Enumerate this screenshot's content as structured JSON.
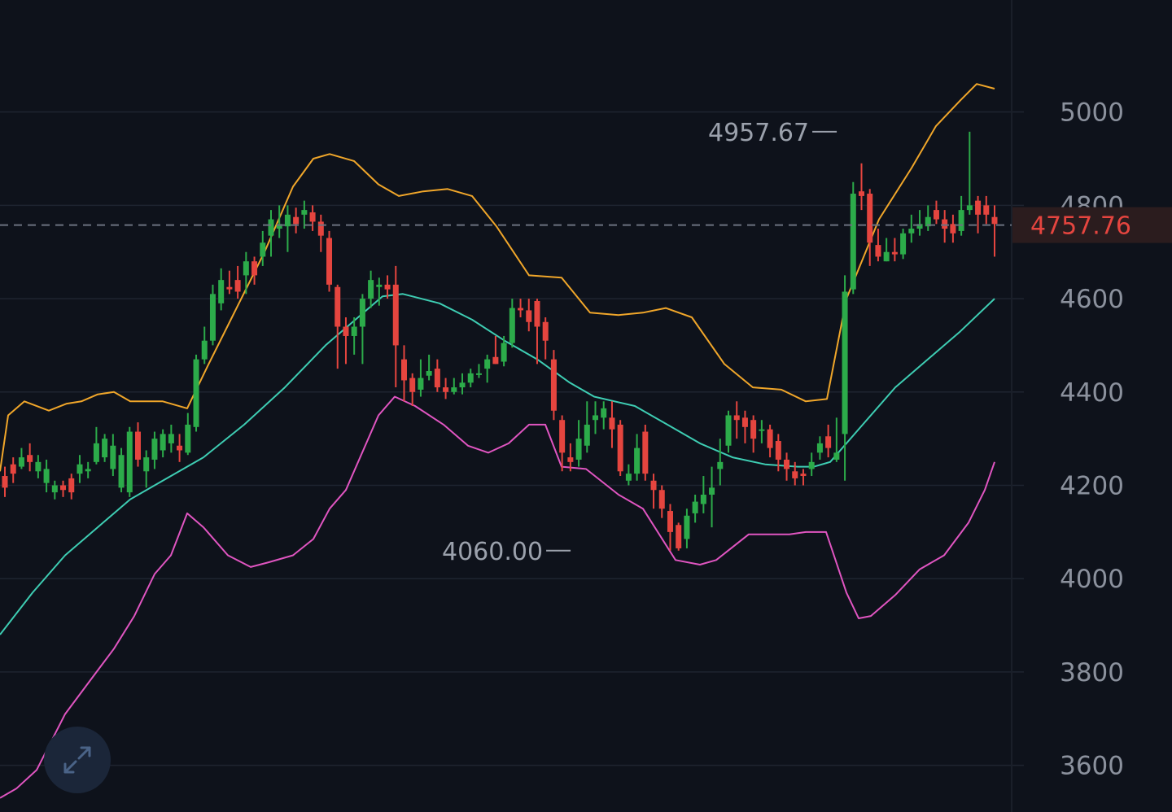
{
  "chart_data": {
    "type": "candlestick",
    "y_axis": {
      "ticks": [
        "5000",
        "4800",
        "4600",
        "4400",
        "4200",
        "4000",
        "3800",
        "3600"
      ],
      "tick_values": [
        5000,
        4800,
        4600,
        4400,
        4200,
        4000,
        3800,
        3600
      ],
      "range": [
        3500,
        5240
      ],
      "position": "right",
      "grid": true
    },
    "current_price": {
      "label": "4757.76",
      "value": 4757.76
    },
    "annotations": [
      {
        "id": "high",
        "label": "4957.67",
        "value": 4957.67,
        "candle_index": 101
      },
      {
        "id": "low",
        "label": "4060.00",
        "value": 4060.0,
        "candle_index": 69
      }
    ],
    "candles": [
      [
        4220,
        4195,
        4240,
        4175
      ],
      [
        4245,
        4225,
        4260,
        4205
      ],
      [
        4240,
        4260,
        4280,
        4235
      ],
      [
        4265,
        4250,
        4290,
        4230
      ],
      [
        4230,
        4250,
        4265,
        4215
      ],
      [
        4205,
        4235,
        4255,
        4185
      ],
      [
        4185,
        4200,
        4210,
        4170
      ],
      [
        4200,
        4190,
        4210,
        4175
      ],
      [
        4215,
        4185,
        4225,
        4170
      ],
      [
        4225,
        4245,
        4265,
        4205
      ],
      [
        4230,
        4235,
        4250,
        4215
      ],
      [
        4250,
        4290,
        4325,
        4245
      ],
      [
        4260,
        4300,
        4310,
        4250
      ],
      [
        4235,
        4285,
        4310,
        4220
      ],
      [
        4195,
        4265,
        4280,
        4185
      ],
      [
        4185,
        4315,
        4325,
        4175
      ],
      [
        4315,
        4255,
        4335,
        4240
      ],
      [
        4230,
        4260,
        4275,
        4195
      ],
      [
        4255,
        4300,
        4315,
        4235
      ],
      [
        4275,
        4310,
        4320,
        4260
      ],
      [
        4290,
        4310,
        4330,
        4270
      ],
      [
        4285,
        4275,
        4310,
        4250
      ],
      [
        4270,
        4330,
        4355,
        4265
      ],
      [
        4325,
        4470,
        4480,
        4315
      ],
      [
        4470,
        4510,
        4540,
        4460
      ],
      [
        4510,
        4610,
        4630,
        4500
      ],
      [
        4590,
        4640,
        4665,
        4575
      ],
      [
        4625,
        4620,
        4660,
        4610
      ],
      [
        4640,
        4615,
        4670,
        4600
      ],
      [
        4650,
        4680,
        4700,
        4610
      ],
      [
        4680,
        4650,
        4690,
        4630
      ],
      [
        4690,
        4720,
        4745,
        4670
      ],
      [
        4735,
        4770,
        4790,
        4690
      ],
      [
        4750,
        4760,
        4800,
        4730
      ],
      [
        4755,
        4780,
        4800,
        4700
      ],
      [
        4775,
        4760,
        4795,
        4740
      ],
      [
        4780,
        4790,
        4810,
        4750
      ],
      [
        4785,
        4765,
        4800,
        4745
      ],
      [
        4765,
        4735,
        4780,
        4700
      ],
      [
        4730,
        4630,
        4745,
        4615
      ],
      [
        4625,
        4540,
        4630,
        4450
      ],
      [
        4540,
        4520,
        4560,
        4460
      ],
      [
        4520,
        4540,
        4560,
        4480
      ],
      [
        4540,
        4600,
        4610,
        4460
      ],
      [
        4600,
        4640,
        4660,
        4580
      ],
      [
        4625,
        4630,
        4645,
        4585
      ],
      [
        4630,
        4620,
        4650,
        4600
      ],
      [
        4630,
        4500,
        4670,
        4410
      ],
      [
        4470,
        4425,
        4500,
        4380
      ],
      [
        4430,
        4400,
        4440,
        4370
      ],
      [
        4405,
        4430,
        4470,
        4390
      ],
      [
        4435,
        4445,
        4480,
        4425
      ],
      [
        4450,
        4410,
        4470,
        4400
      ],
      [
        4410,
        4400,
        4430,
        4385
      ],
      [
        4400,
        4410,
        4430,
        4395
      ],
      [
        4410,
        4420,
        4440,
        4395
      ],
      [
        4420,
        4440,
        4450,
        4410
      ],
      [
        4440,
        4440,
        4460,
        4430
      ],
      [
        4450,
        4470,
        4480,
        4420
      ],
      [
        4475,
        4460,
        4520,
        4460
      ],
      [
        4465,
        4505,
        4520,
        4455
      ],
      [
        4505,
        4580,
        4600,
        4495
      ],
      [
        4580,
        4575,
        4600,
        4560
      ],
      [
        4575,
        4550,
        4600,
        4530
      ],
      [
        4595,
        4540,
        4600,
        4460
      ],
      [
        4550,
        4510,
        4560,
        4470
      ],
      [
        4470,
        4360,
        4490,
        4340
      ],
      [
        4340,
        4270,
        4350,
        4230
      ],
      [
        4260,
        4250,
        4290,
        4230
      ],
      [
        4255,
        4300,
        4340,
        4240
      ],
      [
        4285,
        4330,
        4380,
        4270
      ],
      [
        4340,
        4350,
        4380,
        4310
      ],
      [
        4345,
        4365,
        4380,
        4320
      ],
      [
        4345,
        4320,
        4380,
        4280
      ],
      [
        4330,
        4230,
        4340,
        4220
      ],
      [
        4210,
        4225,
        4245,
        4200
      ],
      [
        4225,
        4280,
        4310,
        4210
      ],
      [
        4315,
        4225,
        4330,
        4210
      ],
      [
        4210,
        4190,
        4225,
        4150
      ],
      [
        4190,
        4150,
        4200,
        4130
      ],
      [
        4145,
        4100,
        4160,
        4060
      ],
      [
        4115,
        4065,
        4120,
        4060
      ],
      [
        4085,
        4135,
        4150,
        4065
      ],
      [
        4140,
        4165,
        4180,
        4120
      ],
      [
        4160,
        4180,
        4220,
        4140
      ],
      [
        4180,
        4195,
        4240,
        4110
      ],
      [
        4235,
        4250,
        4300,
        4200
      ],
      [
        4285,
        4350,
        4360,
        4270
      ],
      [
        4350,
        4340,
        4380,
        4300
      ],
      [
        4345,
        4325,
        4360,
        4290
      ],
      [
        4340,
        4300,
        4350,
        4270
      ],
      [
        4320,
        4320,
        4340,
        4290
      ],
      [
        4320,
        4280,
        4330,
        4260
      ],
      [
        4295,
        4255,
        4310,
        4230
      ],
      [
        4255,
        4235,
        4270,
        4210
      ],
      [
        4230,
        4215,
        4250,
        4200
      ],
      [
        4225,
        4220,
        4235,
        4200
      ],
      [
        4235,
        4250,
        4270,
        4220
      ],
      [
        4270,
        4290,
        4305,
        4255
      ],
      [
        4305,
        4280,
        4330,
        4260
      ],
      [
        4255,
        4270,
        4345,
        4250
      ],
      [
        4310,
        4615,
        4650,
        4210
      ],
      [
        4620,
        4825,
        4850,
        4610
      ],
      [
        4830,
        4820,
        4890,
        4790
      ],
      [
        4825,
        4720,
        4835,
        4670
      ],
      [
        4715,
        4690,
        4750,
        4680
      ],
      [
        4680,
        4700,
        4730,
        4680
      ],
      [
        4700,
        4695,
        4730,
        4680
      ],
      [
        4695,
        4740,
        4750,
        4685
      ],
      [
        4740,
        4750,
        4780,
        4720
      ],
      [
        4750,
        4760,
        4790,
        4735
      ],
      [
        4755,
        4775,
        4800,
        4745
      ],
      [
        4790,
        4770,
        4810,
        4760
      ],
      [
        4770,
        4750,
        4790,
        4720
      ],
      [
        4760,
        4740,
        4780,
        4720
      ],
      [
        4745,
        4790,
        4820,
        4735
      ],
      [
        4790,
        4800,
        4957.67,
        4780
      ],
      [
        4810,
        4780,
        4820,
        4740
      ],
      [
        4800,
        4780,
        4820,
        4760
      ],
      [
        4775,
        4760,
        4800,
        4690
      ]
    ],
    "bollinger": {
      "upper": [
        [
          0,
          4230
        ],
        [
          10,
          4350
        ],
        [
          30,
          4380
        ],
        [
          60,
          4360
        ],
        [
          82,
          4375
        ],
        [
          100,
          4380
        ],
        [
          120,
          4395
        ],
        [
          140,
          4400
        ],
        [
          160,
          4380
        ],
        [
          200,
          4380
        ],
        [
          230,
          4365
        ],
        [
          255,
          4455
        ],
        [
          285,
          4560
        ],
        [
          325,
          4700
        ],
        [
          360,
          4840
        ],
        [
          385,
          4900
        ],
        [
          405,
          4910
        ],
        [
          435,
          4895
        ],
        [
          465,
          4845
        ],
        [
          490,
          4820
        ],
        [
          520,
          4830
        ],
        [
          550,
          4835
        ],
        [
          580,
          4820
        ],
        [
          610,
          4755
        ],
        [
          650,
          4650
        ],
        [
          690,
          4645
        ],
        [
          725,
          4570
        ],
        [
          760,
          4565
        ],
        [
          790,
          4570
        ],
        [
          818,
          4580
        ],
        [
          850,
          4560
        ],
        [
          890,
          4460
        ],
        [
          925,
          4410
        ],
        [
          960,
          4405
        ],
        [
          990,
          4380
        ],
        [
          1016,
          4385
        ],
        [
          1040,
          4600
        ],
        [
          1080,
          4770
        ],
        [
          1120,
          4880
        ],
        [
          1150,
          4970
        ],
        [
          1180,
          5025
        ],
        [
          1200,
          5060
        ],
        [
          1222,
          5050
        ]
      ],
      "middle": [
        [
          0,
          3880
        ],
        [
          40,
          3970
        ],
        [
          80,
          4050
        ],
        [
          120,
          4110
        ],
        [
          160,
          4170
        ],
        [
          200,
          4210
        ],
        [
          250,
          4260
        ],
        [
          300,
          4330
        ],
        [
          350,
          4410
        ],
        [
          400,
          4500
        ],
        [
          440,
          4560
        ],
        [
          470,
          4605
        ],
        [
          495,
          4610
        ],
        [
          540,
          4590
        ],
        [
          580,
          4555
        ],
        [
          620,
          4510
        ],
        [
          660,
          4470
        ],
        [
          700,
          4420
        ],
        [
          730,
          4390
        ],
        [
          780,
          4370
        ],
        [
          820,
          4330
        ],
        [
          860,
          4290
        ],
        [
          900,
          4260
        ],
        [
          940,
          4245
        ],
        [
          980,
          4240
        ],
        [
          1000,
          4240
        ],
        [
          1020,
          4250
        ],
        [
          1060,
          4330
        ],
        [
          1100,
          4410
        ],
        [
          1140,
          4470
        ],
        [
          1180,
          4530
        ],
        [
          1222,
          4600
        ]
      ],
      "lower": [
        [
          0,
          3530
        ],
        [
          20,
          3550
        ],
        [
          45,
          3590
        ],
        [
          80,
          3710
        ],
        [
          110,
          3780
        ],
        [
          140,
          3850
        ],
        [
          165,
          3920
        ],
        [
          190,
          4010
        ],
        [
          210,
          4050
        ],
        [
          230,
          4140
        ],
        [
          250,
          4110
        ],
        [
          280,
          4050
        ],
        [
          308,
          4025
        ],
        [
          330,
          4035
        ],
        [
          360,
          4050
        ],
        [
          385,
          4085
        ],
        [
          405,
          4150
        ],
        [
          425,
          4190
        ],
        [
          465,
          4350
        ],
        [
          485,
          4390
        ],
        [
          510,
          4370
        ],
        [
          545,
          4330
        ],
        [
          575,
          4285
        ],
        [
          600,
          4270
        ],
        [
          625,
          4290
        ],
        [
          650,
          4330
        ],
        [
          670,
          4330
        ],
        [
          690,
          4240
        ],
        [
          720,
          4235
        ],
        [
          760,
          4180
        ],
        [
          790,
          4150
        ],
        [
          830,
          4040
        ],
        [
          860,
          4030
        ],
        [
          880,
          4040
        ],
        [
          920,
          4095
        ],
        [
          970,
          4095
        ],
        [
          990,
          4100
        ],
        [
          1015,
          4100
        ],
        [
          1040,
          3970
        ],
        [
          1055,
          3915
        ],
        [
          1070,
          3920
        ],
        [
          1100,
          3965
        ],
        [
          1130,
          4020
        ],
        [
          1160,
          4050
        ],
        [
          1190,
          4120
        ],
        [
          1210,
          4190
        ],
        [
          1222,
          4250
        ]
      ]
    },
    "colors": {
      "background": "#0e121b",
      "up": "#2cab4a",
      "down": "#e5453f",
      "upper_band": "#f0a62a",
      "middle_band": "#3ecdb3",
      "lower_band": "#e055c1",
      "grid": "#1e2430",
      "axis_text": "#8b919d",
      "price_tag_bg": "#2b1c1e"
    }
  },
  "ui": {
    "expand_icon": "expand-arrows-icon"
  }
}
